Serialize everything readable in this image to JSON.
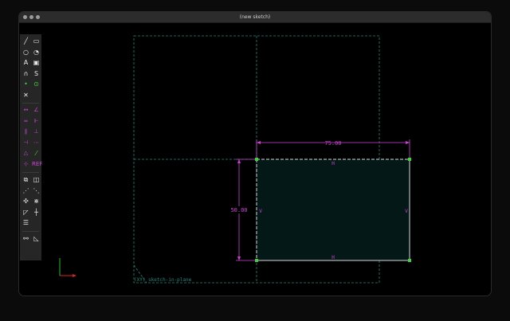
{
  "window": {
    "title": "(new sketch)"
  },
  "toolbar": {
    "groups": [
      {
        "tools": [
          {
            "name": "line-icon",
            "glyph": "╱",
            "color": "white"
          },
          {
            "name": "rectangle-icon",
            "glyph": "▭",
            "color": "white"
          },
          {
            "name": "circle-icon",
            "glyph": "○",
            "color": "white"
          },
          {
            "name": "arc-icon",
            "glyph": "◔",
            "color": "white"
          },
          {
            "name": "text-icon",
            "glyph": "A",
            "color": "white"
          },
          {
            "name": "image-icon",
            "glyph": "▣",
            "color": "white"
          },
          {
            "name": "bezier-icon",
            "glyph": "∩",
            "color": "white"
          },
          {
            "name": "spline-icon",
            "glyph": "S",
            "color": "white"
          },
          {
            "name": "point-icon",
            "glyph": "•",
            "color": "green"
          },
          {
            "name": "construction-icon",
            "glyph": "⊙",
            "color": "green"
          },
          {
            "name": "trim-icon",
            "glyph": "✕",
            "color": "white"
          }
        ]
      },
      {
        "tools": [
          {
            "name": "dimension-icon",
            "glyph": "↔",
            "color": "magenta"
          },
          {
            "name": "angle-icon",
            "glyph": "∠",
            "color": "magenta"
          },
          {
            "name": "horizontal-icon",
            "glyph": "═",
            "color": "magenta"
          },
          {
            "name": "vertical-icon",
            "glyph": "⊩",
            "color": "magenta"
          },
          {
            "name": "parallel-icon",
            "glyph": "∥",
            "color": "magenta"
          },
          {
            "name": "perpendicular-icon",
            "glyph": "⊥",
            "color": "magenta"
          },
          {
            "name": "tangent-icon",
            "glyph": "⊣",
            "color": "magenta"
          },
          {
            "name": "equal-icon",
            "glyph": "⋯",
            "color": "magenta"
          },
          {
            "name": "symmetric-icon",
            "glyph": "△",
            "color": "magenta"
          },
          {
            "name": "midpoint-icon",
            "glyph": "⁄",
            "color": "green"
          },
          {
            "name": "fix-icon",
            "glyph": "⊹",
            "color": "magenta"
          },
          {
            "name": "reference-icon",
            "glyph": "REF",
            "color": "magenta"
          }
        ]
      },
      {
        "tools": [
          {
            "name": "extrude-icon",
            "glyph": "⧉",
            "color": "white"
          },
          {
            "name": "lathe-icon",
            "glyph": "◫",
            "color": "white"
          },
          {
            "name": "step-translate-icon",
            "glyph": "⋰",
            "color": "white"
          },
          {
            "name": "step-rotate-icon",
            "glyph": "⋱",
            "color": "white"
          },
          {
            "name": "snap-icon",
            "glyph": "✣",
            "color": "white"
          },
          {
            "name": "split-icon",
            "glyph": "⋇",
            "color": "white"
          },
          {
            "name": "nearest-icon",
            "glyph": "◸",
            "color": "white"
          },
          {
            "name": "workplane-icon",
            "glyph": "┼",
            "color": "white"
          },
          {
            "name": "group-icon",
            "glyph": "☰",
            "color": "white"
          }
        ]
      },
      {
        "tools": [
          {
            "name": "assemble-icon",
            "glyph": "⚯",
            "color": "white"
          },
          {
            "name": "step-icon",
            "glyph": "◺",
            "color": "white"
          }
        ]
      }
    ]
  },
  "sketch": {
    "dimension_horizontal": "75.00",
    "dimension_vertical": "50.00",
    "constraint_h": "H",
    "constraint_v": "V",
    "workplane_label": "(XY) sketch-in-plane",
    "colors": {
      "construction": "#1f8a7a",
      "geometry": "#d8d8d8",
      "dimension": "#d040d8",
      "point": "#40d040",
      "fill": "#041818",
      "axis_x": "#e02020",
      "axis_y": "#20c020"
    }
  }
}
